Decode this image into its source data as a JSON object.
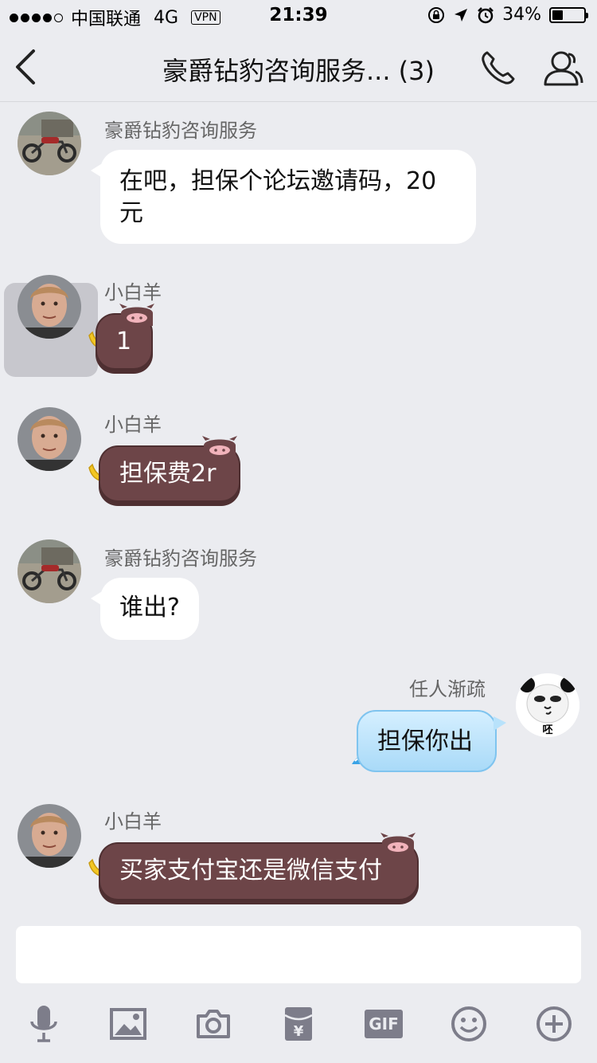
{
  "status_bar": {
    "carrier": "中国联通",
    "network": "4G",
    "vpn": "VPN",
    "time": "21:39",
    "battery_text": "34%",
    "battery_level": 0.34
  },
  "nav": {
    "title": "豪爵钻豹咨询服务... (3)"
  },
  "messages": [
    {
      "sender": "豪爵钻豹咨询服务",
      "text_line1": "在吧，担保个论坛邀请码，20",
      "text_line2": "元"
    },
    {
      "sender": "小白羊",
      "text": "1"
    },
    {
      "sender": "小白羊",
      "text": "担保费2r"
    },
    {
      "sender": "豪爵钻豹咨询服务",
      "text": "谁出?"
    },
    {
      "sender": "任人渐疏",
      "text": "担保你出",
      "avatar_caption": "呸"
    },
    {
      "sender": "小白羊",
      "text": "买家支付宝还是微信支付"
    }
  ],
  "toolbar": {
    "icons": [
      "microphone-icon",
      "image-icon",
      "camera-icon",
      "red-packet-icon",
      "gif-icon",
      "emoji-icon",
      "plus-icon"
    ],
    "gif_label": "GIF",
    "red_packet_symbol": "¥"
  },
  "colors": {
    "background": "#ebecf0",
    "pig_bubble": "#6d4548",
    "blue_bubble": "#a9daf8",
    "icon_gray": "#7d7d8a"
  }
}
